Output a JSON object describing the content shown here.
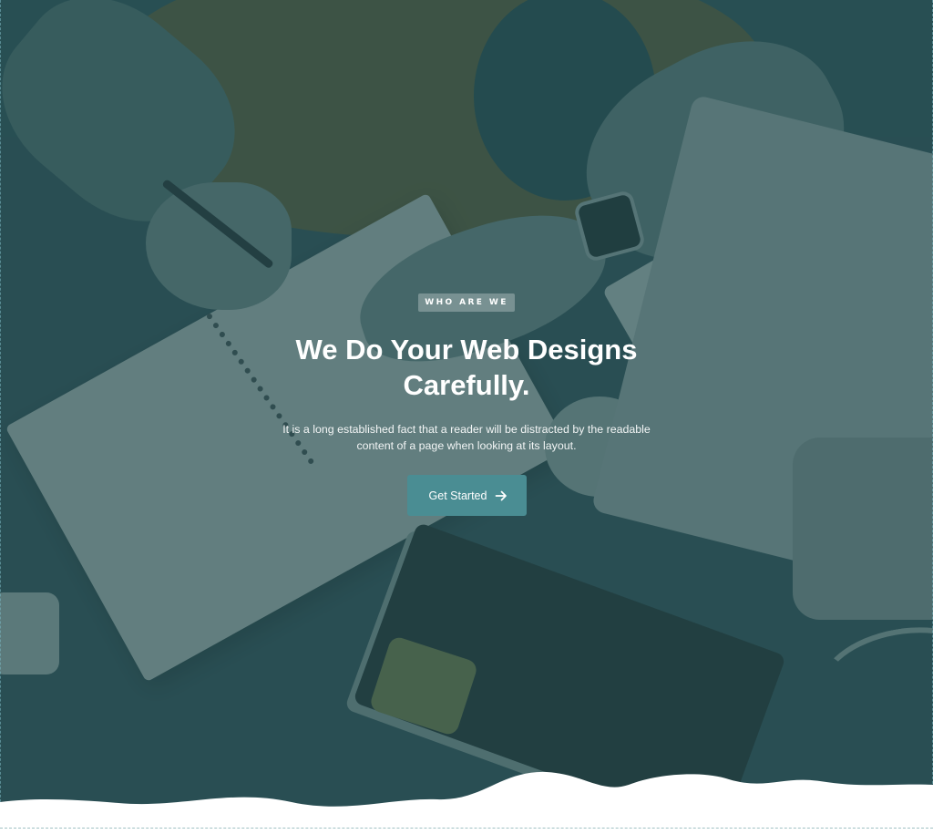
{
  "hero": {
    "eyebrow": "WHO ARE WE",
    "headline_line1": "We Do Your Web Designs",
    "headline_line2": "Carefully.",
    "description": "It is a long established fact that a reader will be distracted by the readable content of a page when looking at its layout.",
    "cta": {
      "label": "Get Started",
      "icon": "arrow-right-icon"
    },
    "background_image": "desk-workspace-photo",
    "overlay_color": "#264e52",
    "cta_color": "#4a8d93"
  }
}
